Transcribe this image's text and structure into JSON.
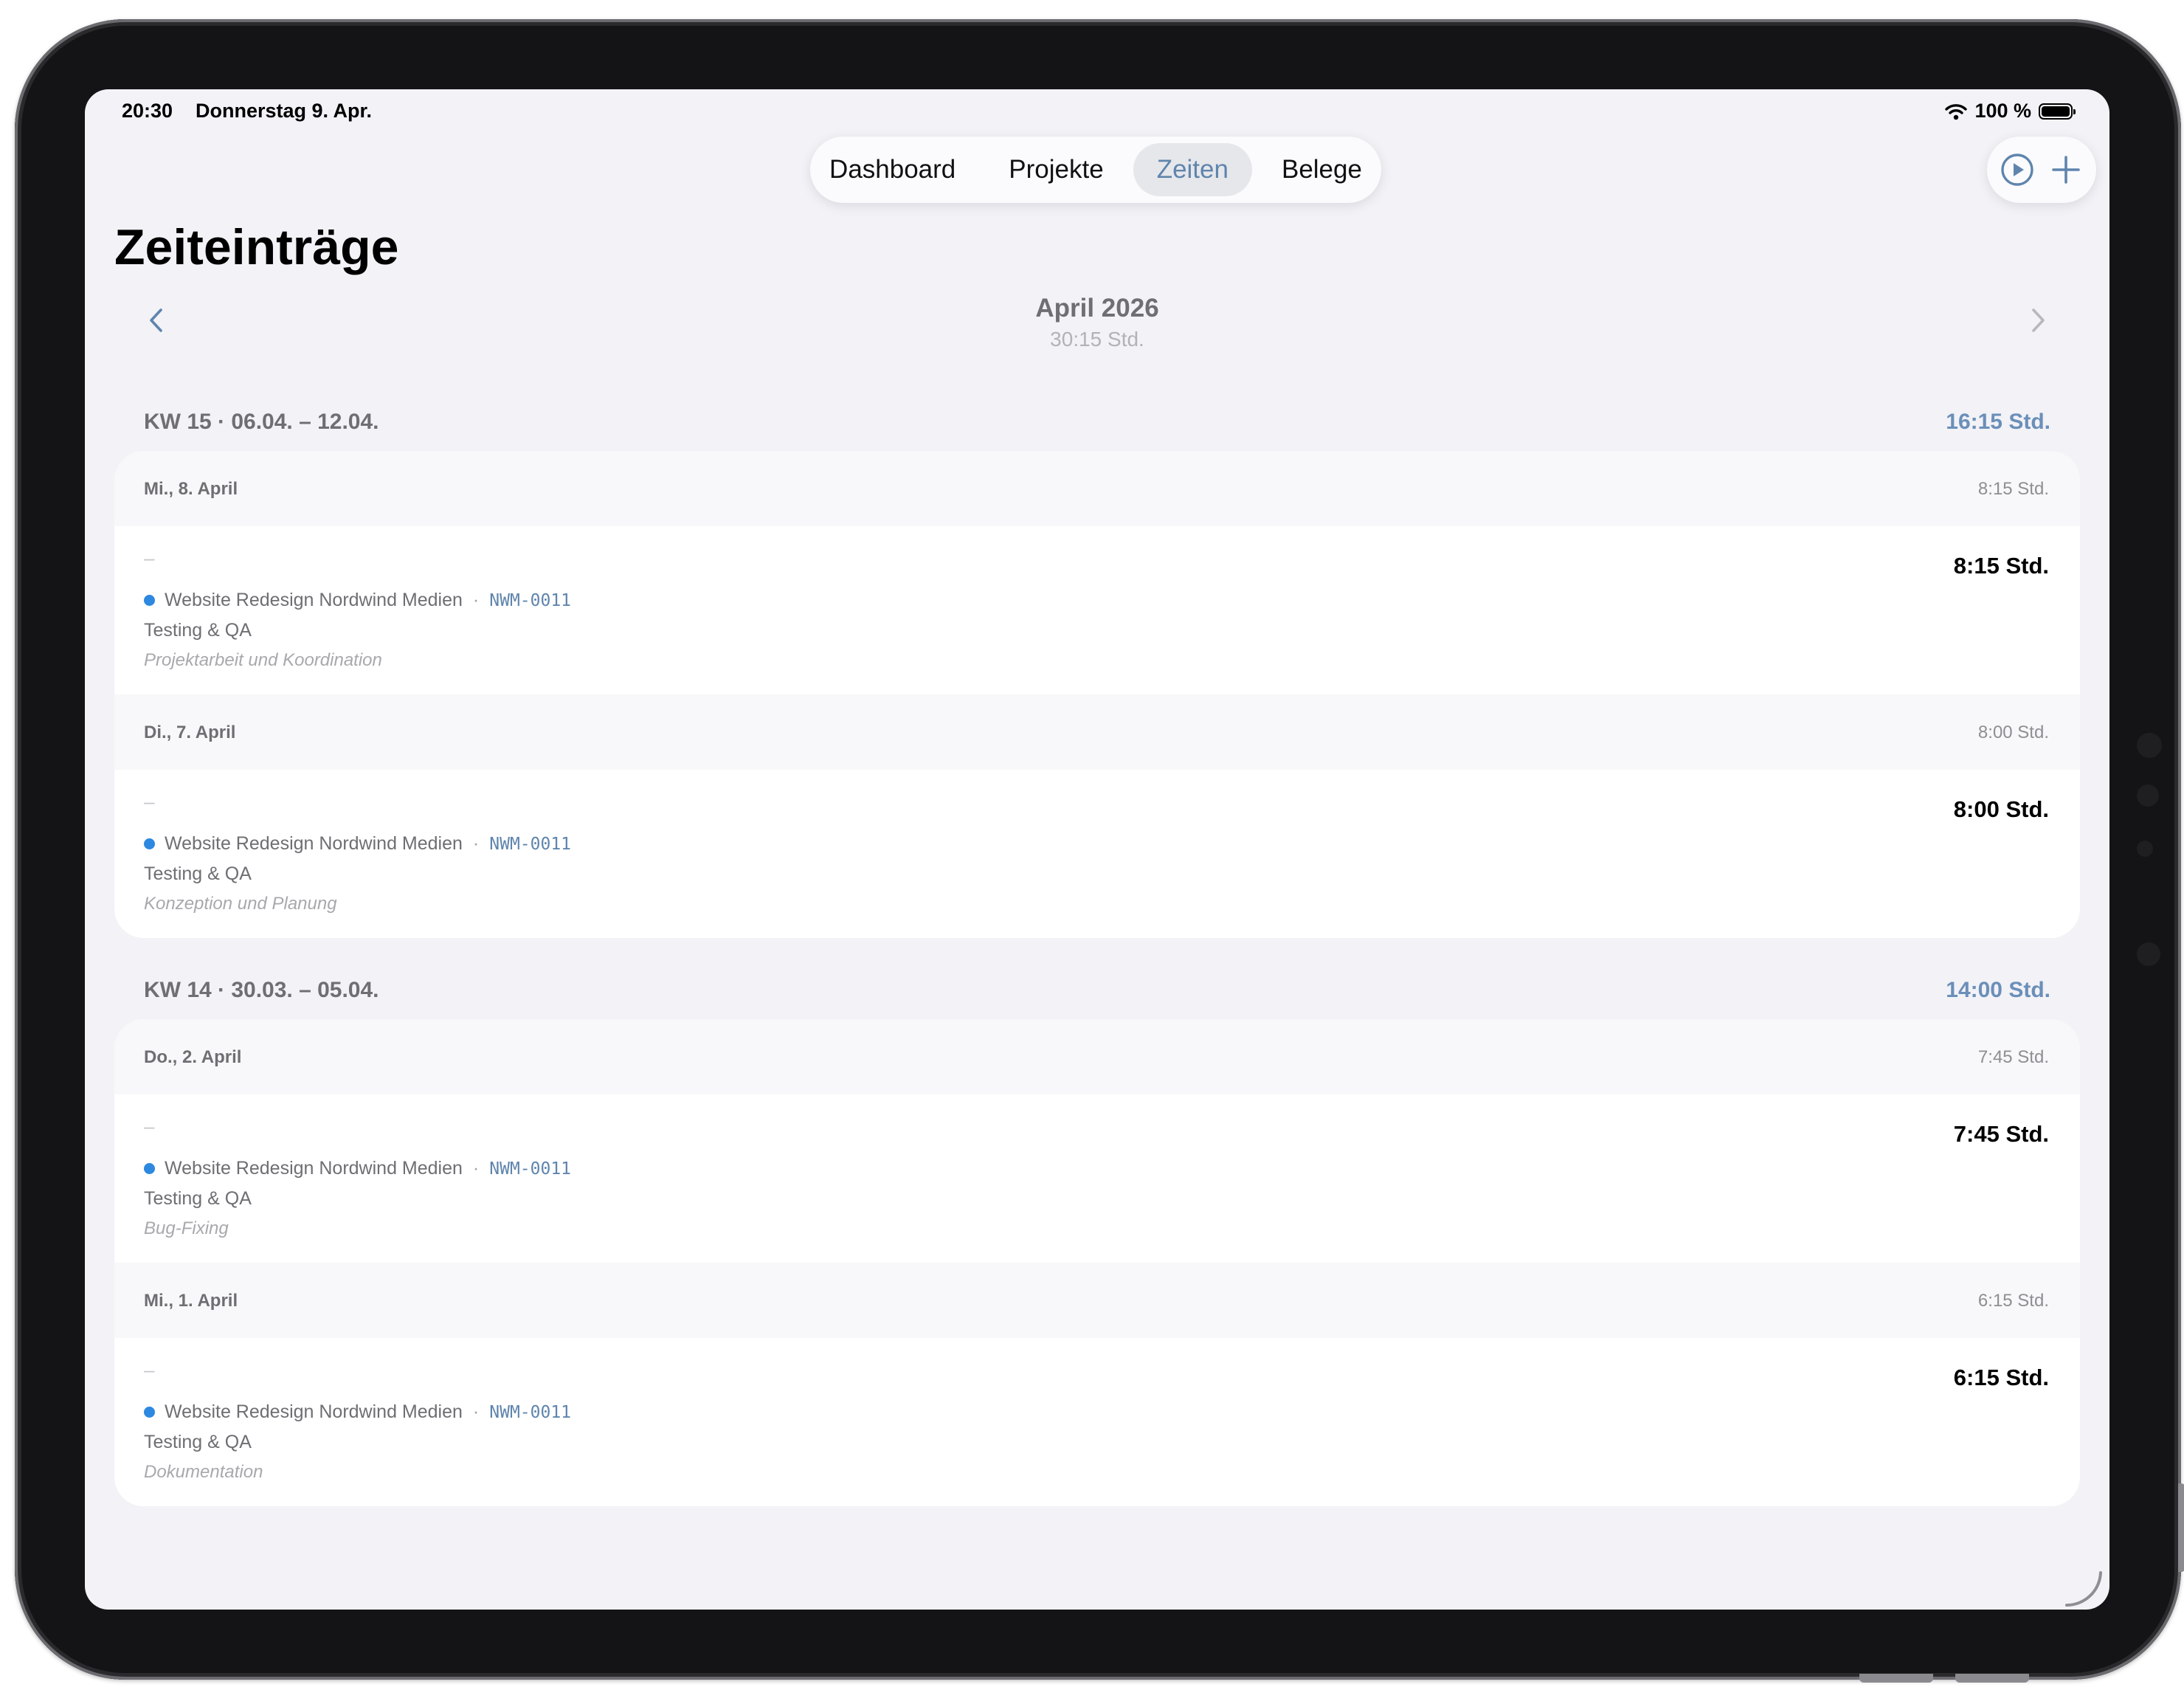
{
  "status": {
    "time": "20:30",
    "date": "Donnerstag 9. Apr.",
    "battery": "100 %"
  },
  "tabs": [
    {
      "label": "Dashboard"
    },
    {
      "label": "Projekte"
    },
    {
      "label": "Zeiten",
      "active": true
    },
    {
      "label": "Belege"
    }
  ],
  "toolbar": {
    "play_icon": "play-circle-icon",
    "add_icon": "plus-icon"
  },
  "page": {
    "title": "Zeiteinträge"
  },
  "month": {
    "title": "April 2026",
    "total": "30:15 Std."
  },
  "weeks": [
    {
      "label": "KW 15 · 06.04. – 12.04.",
      "total": "16:15 Std.",
      "days": [
        {
          "label": "Mi., 8. April",
          "total": "8:15 Std.",
          "entry": {
            "dash": "–",
            "project": "Website Redesign Nordwind Medien",
            "separator": "·",
            "code": "NWM-0011",
            "task": "Testing & QA",
            "note": "Projektarbeit und Koordination",
            "duration": "8:15 Std."
          }
        },
        {
          "label": "Di., 7. April",
          "total": "8:00 Std.",
          "entry": {
            "dash": "–",
            "project": "Website Redesign Nordwind Medien",
            "separator": "·",
            "code": "NWM-0011",
            "task": "Testing & QA",
            "note": "Konzeption und Planung",
            "duration": "8:00 Std."
          }
        }
      ]
    },
    {
      "label": "KW 14 · 30.03. – 05.04.",
      "total": "14:00 Std.",
      "days": [
        {
          "label": "Do., 2. April",
          "total": "7:45 Std.",
          "entry": {
            "dash": "–",
            "project": "Website Redesign Nordwind Medien",
            "separator": "·",
            "code": "NWM-0011",
            "task": "Testing & QA",
            "note": "Bug-Fixing",
            "duration": "7:45 Std."
          }
        },
        {
          "label": "Mi., 1. April",
          "total": "6:15 Std.",
          "entry": {
            "dash": "–",
            "project": "Website Redesign Nordwind Medien",
            "separator": "·",
            "code": "NWM-0011",
            "task": "Testing & QA",
            "note": "Dokumentation",
            "duration": "6:15 Std."
          }
        }
      ]
    }
  ],
  "colors": {
    "accent": "#5f85ad",
    "project_dot": "#2d88e0",
    "background": "#f2f2f7"
  }
}
